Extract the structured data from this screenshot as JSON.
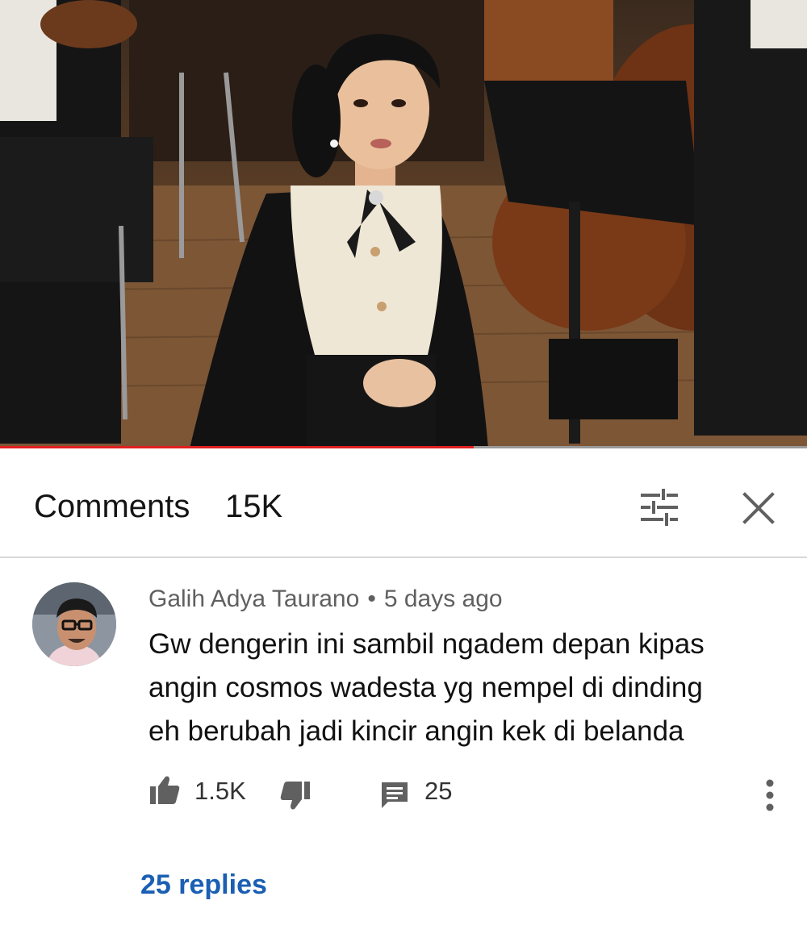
{
  "video": {
    "progress_fraction": 0.587,
    "colors": {
      "progress": "#e02020",
      "track": "#9a9a9a"
    }
  },
  "comments": {
    "title": "Comments",
    "count": "15K",
    "icons": {
      "filter": "sort-filter-icon",
      "close": "close-icon"
    }
  },
  "comment": {
    "author": "Galih Adya Taurano",
    "separator": "•",
    "time": "5 days ago",
    "lines": [
      "Gw dengerin ini sambil ngadem depan kipas",
      "angin cosmos wadesta yg nempel di dinding",
      "eh berubah jadi kincir angin kek di belanda"
    ],
    "likes": "1.5K",
    "reply_count": "25",
    "replies_link": "25 replies",
    "icons": {
      "like": "thumbs-up-icon",
      "dislike": "thumbs-down-icon",
      "reply": "reply-icon",
      "more": "more-vert-icon"
    }
  },
  "colors": {
    "link": "#1a5fb4",
    "meta": "#606060",
    "text": "#111111"
  }
}
